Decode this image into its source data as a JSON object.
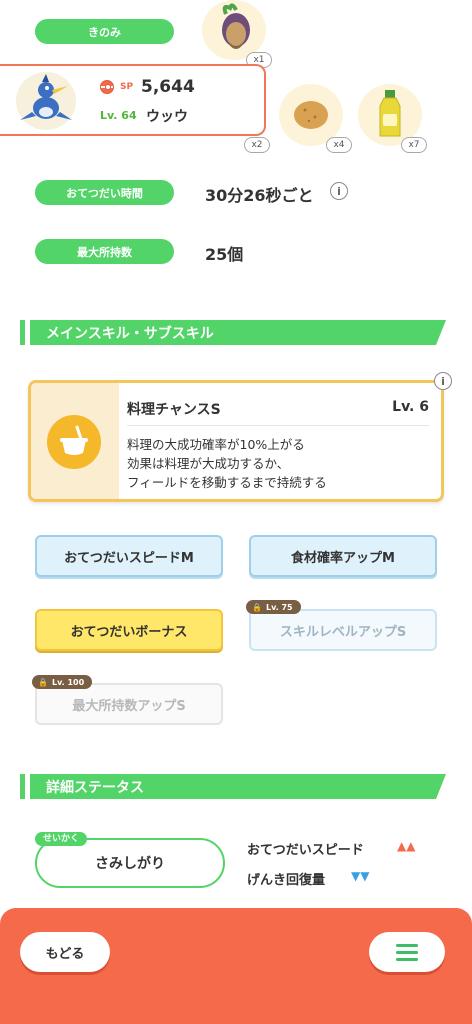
{
  "ingredients": {
    "label": "きのみ",
    "items": [
      {
        "name": "onion",
        "icon": "onion-icon",
        "qty": "x1"
      },
      {
        "name": "potato",
        "icon": "potato-icon",
        "qty": "x4"
      },
      {
        "name": "oil",
        "icon": "oil-bottle-icon",
        "qty": "x7"
      }
    ],
    "extra_qty": "x2"
  },
  "pokemon": {
    "sp_label": "SP",
    "sp_value": "5,644",
    "level": "Lv. 64",
    "name": "ウッウ"
  },
  "stats": {
    "help_time_label": "おてつだい時間",
    "help_time_value": "30分26秒ごと",
    "max_carry_label": "最大所持数",
    "max_carry_value": "25個"
  },
  "main_skill_section": {
    "title": "メインスキル・サブスキル",
    "skill": {
      "name": "料理チャンスS",
      "level": "Lv. 6",
      "desc_line1": "料理の大成功確率が10%上がる",
      "desc_line2": "効果は料理が大成功するか、",
      "desc_line3": "フィールドを移動するまで持続する"
    },
    "sub_skills": [
      {
        "label": "おてつだいスピードM",
        "state": "active"
      },
      {
        "label": "食材確率アップM",
        "state": "active"
      },
      {
        "label": "おてつだいボーナス",
        "state": "gold"
      },
      {
        "label": "スキルレベルアップS",
        "state": "locked",
        "unlock": "Lv. 75"
      },
      {
        "label": "最大所持数アップS",
        "state": "locked",
        "unlock": "Lv. 100"
      }
    ]
  },
  "detail_section": {
    "title": "詳細ステータス",
    "nature_tag": "せいかく",
    "nature": "さみしがり",
    "up_stat": "おてつだいスピード",
    "up_marks": "▲▲",
    "down_stat": "げんき回復量",
    "down_marks": "▼▼",
    "up_color": "#f56a4b",
    "down_color": "#3aa0e6"
  },
  "footer": {
    "back_label": "もどる",
    "menu_icon": "hamburger-menu-icon"
  }
}
